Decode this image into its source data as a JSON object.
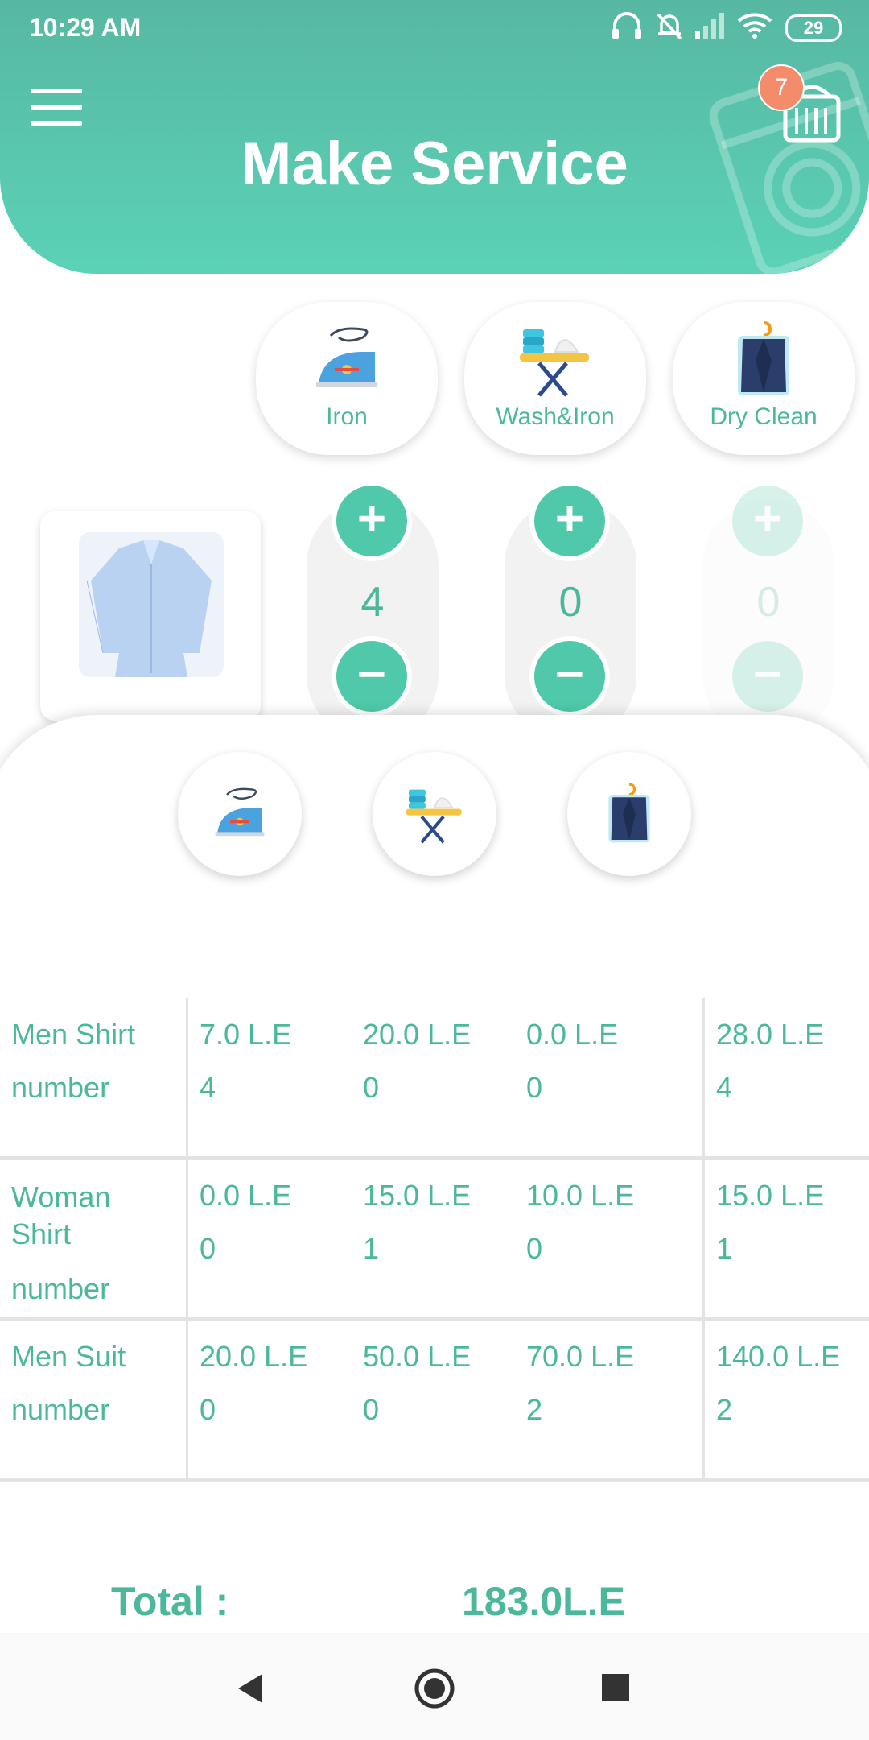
{
  "status_bar": {
    "time": "10:29 AM",
    "battery": "29"
  },
  "header": {
    "title": "Make Service",
    "cart_count": "7"
  },
  "services": [
    {
      "label": "Iron",
      "icon": "iron-icon"
    },
    {
      "label": "Wash&Iron",
      "icon": "ironing-board-icon"
    },
    {
      "label": "Dry Clean",
      "icon": "dry-clean-jacket-icon"
    }
  ],
  "product": {
    "name": "Men Shirt",
    "image": "shirt-photo"
  },
  "steppers": [
    {
      "plus": "+",
      "qty": "4",
      "minus": "−"
    },
    {
      "plus": "+",
      "qty": "0",
      "minus": "−"
    },
    {
      "plus": "+",
      "qty": "0",
      "minus": "−"
    }
  ],
  "summary_table": {
    "rows": [
      {
        "item": "Men Shirt",
        "number_label": "number",
        "prices": [
          "7.0 L.E",
          "20.0 L.E",
          "0.0 L.E"
        ],
        "total": "28.0 L.E",
        "counts": [
          "4",
          "0",
          "0"
        ],
        "total_count": "4"
      },
      {
        "item": "Woman Shirt",
        "number_label": "number",
        "prices": [
          "0.0 L.E",
          "15.0 L.E",
          "10.0 L.E"
        ],
        "total": "15.0 L.E",
        "counts": [
          "0",
          "1",
          "0"
        ],
        "total_count": "1"
      },
      {
        "item": "Men Suit",
        "number_label": "number",
        "prices": [
          "20.0 L.E",
          "50.0 L.E",
          "70.0 L.E"
        ],
        "total": "140.0 L.E",
        "counts": [
          "0",
          "0",
          "2"
        ],
        "total_count": "2"
      }
    ]
  },
  "total": {
    "label": "Total :",
    "value": "183.0L.E"
  },
  "colors": {
    "accent": "#4fc9a9",
    "text": "#4bb89c",
    "header_top": "#57b8a2",
    "header_bottom": "#5bd2b6"
  }
}
